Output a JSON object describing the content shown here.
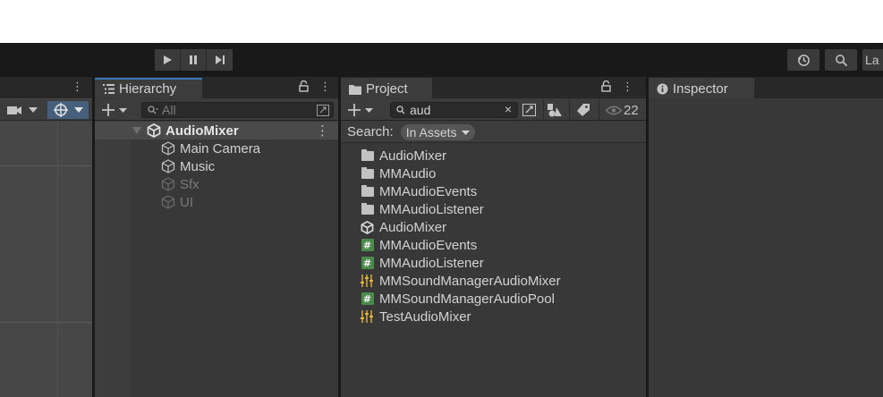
{
  "toolbar": {
    "play_icon": "play-icon",
    "pause_icon": "pause-icon",
    "step_icon": "step-icon",
    "history_icon": "history-icon",
    "search_icon": "search-icon",
    "layers_label": "La"
  },
  "hierarchy": {
    "tab_label": "Hierarchy",
    "search_placeholder": "All",
    "root": "AudioMixer",
    "children": [
      {
        "label": "Main Camera",
        "active": true
      },
      {
        "label": "Music",
        "active": true
      },
      {
        "label": "Sfx",
        "active": false
      },
      {
        "label": "UI",
        "active": false
      }
    ]
  },
  "project": {
    "tab_label": "Project",
    "search_value": "aud",
    "count": "22",
    "search_label": "Search:",
    "scope": "In Assets",
    "items": [
      {
        "label": "AudioMixer",
        "icon": "folder-icon"
      },
      {
        "label": "MMAudio",
        "icon": "folder-icon"
      },
      {
        "label": "MMAudioEvents",
        "icon": "folder-icon"
      },
      {
        "label": "MMAudioListener",
        "icon": "folder-icon"
      },
      {
        "label": "AudioMixer",
        "icon": "unity-scene-icon"
      },
      {
        "label": "MMAudioEvents",
        "icon": "script-icon"
      },
      {
        "label": "MMAudioListener",
        "icon": "script-icon"
      },
      {
        "label": "MMSoundManagerAudioMixer",
        "icon": "audio-mixer-icon"
      },
      {
        "label": "MMSoundManagerAudioPool",
        "icon": "script-icon"
      },
      {
        "label": "TestAudioMixer",
        "icon": "audio-mixer-icon"
      }
    ]
  },
  "inspector": {
    "tab_label": "Inspector"
  },
  "colors": {
    "accent": "#3a79bb",
    "script_green": "#4a8a4a",
    "mixer_orange": "#e7b23a"
  }
}
